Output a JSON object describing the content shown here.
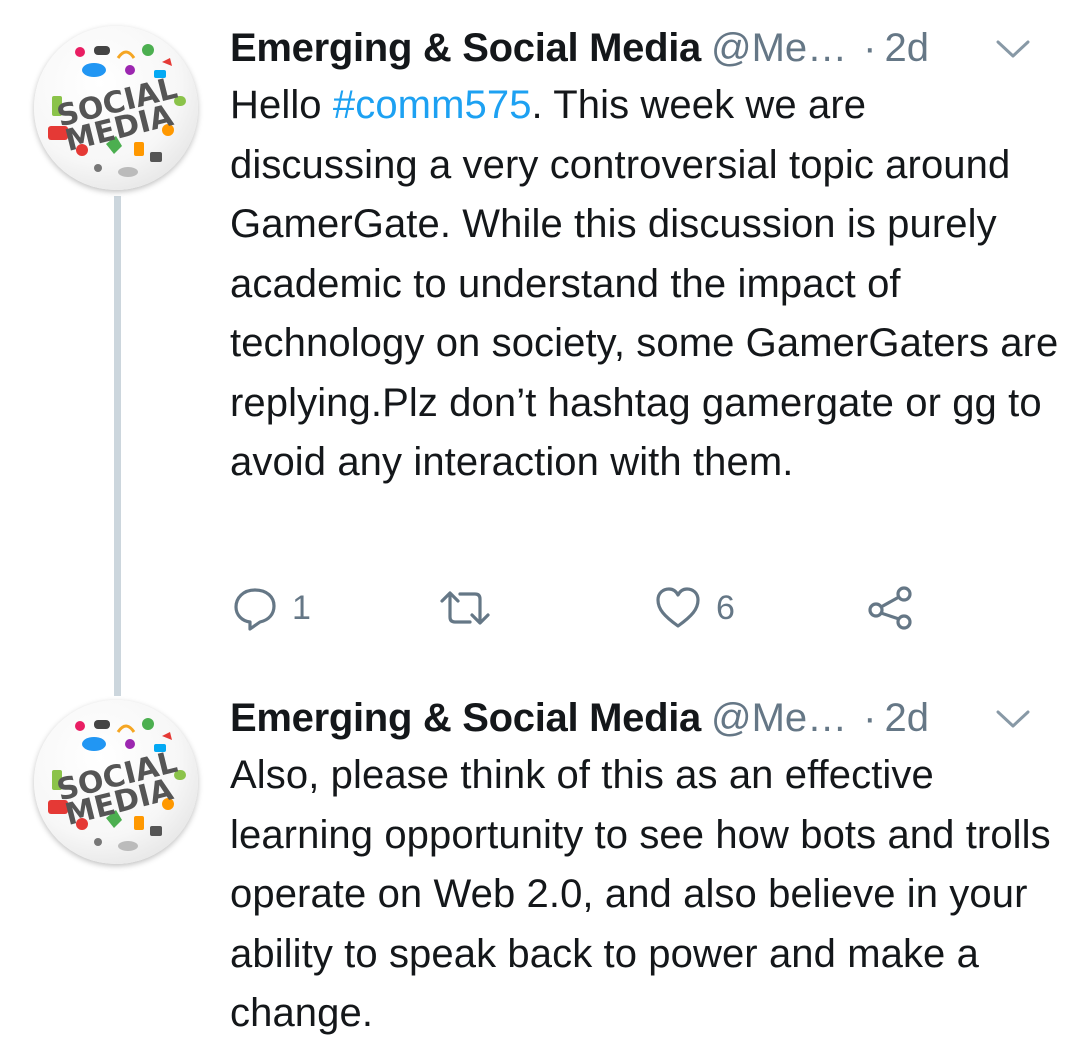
{
  "tweets": [
    {
      "author": {
        "display_name": "Emerging & Social Media",
        "handle": "@Me…",
        "avatar_text_top": "SOCIAL",
        "avatar_text_bottom": "MEDIA"
      },
      "separator": "·",
      "time": "2d",
      "text_before": "Hello ",
      "hashtag": "#comm575",
      "text_after": ". This week we are discussing a very controversial topic around GamerGate. While this discussion is purely academic to understand the impact of technology on society, some GamerGaters are replying.Plz don’t hashtag gamergate or gg to avoid any interaction with them.",
      "actions": {
        "reply_count": "1",
        "retweet_count": "",
        "like_count": "6"
      }
    },
    {
      "author": {
        "display_name": "Emerging & Social Media",
        "handle": "@Me…",
        "avatar_text_top": "SOCIAL",
        "avatar_text_bottom": "MEDIA"
      },
      "separator": "·",
      "time": "2d",
      "text": "Also, please think of this as an effective learning opportunity to see how bots and trolls operate on Web 2.0, and also believe in your ability to speak back to power and make a change."
    }
  ],
  "colors": {
    "text": "#14171a",
    "secondary": "#657786",
    "link": "#1da1f2",
    "thread_line": "#ccd6dd"
  },
  "icons": {
    "reply": "speech-bubble",
    "retweet": "retweet-arrows",
    "like": "heart-outline",
    "share": "share-nodes",
    "menu": "chevron-down"
  }
}
